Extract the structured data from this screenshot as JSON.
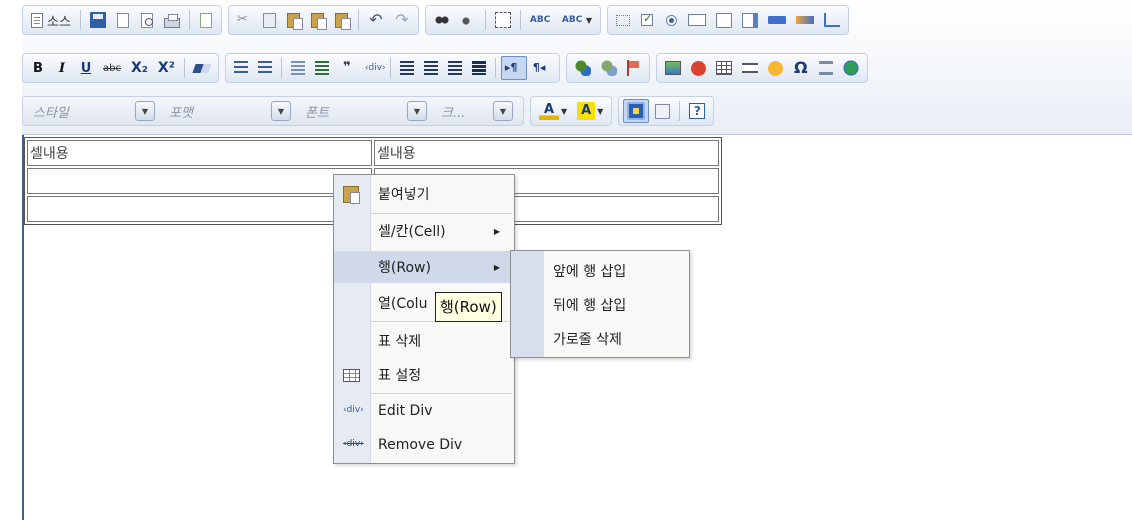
{
  "toolbar": {
    "source_label": "소스",
    "style_combo_label": "스타일",
    "format_combo_label": "포맷",
    "font_combo_label": "폰트",
    "size_combo_label": "크...",
    "bold": "B",
    "italic": "I",
    "underline": "U",
    "strike": "abc",
    "subscript": "X₂",
    "superscript": "X²",
    "help": "?",
    "icons": [
      "document-icon",
      "save-icon",
      "new-page-icon",
      "preview-icon",
      "print-icon",
      "templates-icon",
      "cut-icon",
      "copy-icon",
      "paste-icon",
      "paste-text-icon",
      "paste-word-icon",
      "undo-icon",
      "redo-icon",
      "find-icon",
      "replace-icon",
      "select-all-icon",
      "spellcheck-icon",
      "form-icon",
      "checkbox-icon",
      "radio-icon",
      "textfield-icon",
      "textarea-icon",
      "select-icon",
      "button-icon",
      "image-button-icon",
      "hidden-field-icon",
      "image-icon",
      "flash-icon",
      "table-icon",
      "horizontal-rule-icon",
      "smiley-icon",
      "special-char-icon",
      "page-break-icon",
      "iframe-icon",
      "maximize-icon",
      "show-blocks-icon",
      "help-icon"
    ]
  },
  "table": {
    "rows": [
      [
        "셀내용",
        "셀내용"
      ],
      [
        "",
        ""
      ],
      [
        "",
        ""
      ]
    ]
  },
  "context_menu": {
    "items": [
      {
        "label": "붙여넣기",
        "icon": "paste-icon"
      },
      {
        "label": "셀/칸(Cell)",
        "submenu": true
      },
      {
        "label": "행(Row)",
        "submenu": true,
        "hovered": true
      },
      {
        "label": "열(Column)",
        "submenu": true
      },
      {
        "label": "표 삭제"
      },
      {
        "label": "표 설정",
        "icon": "table-icon"
      },
      {
        "label": "Edit Div",
        "icon": "div-icon"
      },
      {
        "label": "Remove Div",
        "icon": "remove-div-icon"
      }
    ],
    "column_label_visible": "열(Colu"
  },
  "row_submenu": {
    "items": [
      {
        "label": "앞에 행 삽입"
      },
      {
        "label": "뒤에 행 삽입"
      },
      {
        "label": "가로줄 삭제"
      }
    ]
  },
  "tooltip": {
    "text": "행(Row)"
  },
  "colors": {
    "toolbar_bg": "#e9eef5",
    "menu_hover": "#cfd9ea",
    "tooltip_bg": "#ffffe1",
    "editor_border": "#3b5d92"
  }
}
